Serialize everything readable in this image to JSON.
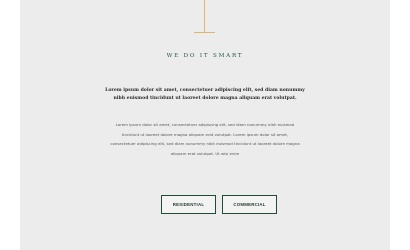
{
  "section": {
    "eyebrow": "WE DO IT SMART",
    "lead": "Lorem ipsum dolor sit amet, consectetuer adipiscing elit, sed diam nonummy nibh euismod tincidunt ut laoreet dolore magna aliquam erat volutpat.",
    "body": "Lorem ipsum dolor sit amet, consectetuer adipiscing elit, sed diam nonummy nibh euismod tincidunt ut laoreet dolore magna aliquam erat volutpat. Lorem ipsum dolor sit amet, consectetuer adipiscing elit, sed diam nonummy nibh euismod tincidunt ut laoreet dolore magna aliquam erat volutpat. Ut wisi enim"
  },
  "buttons": {
    "residential": "RESIDENTIAL",
    "commercial": "COMMERCIAL"
  },
  "colors": {
    "accent_line": "#e2b46a",
    "heading_green": "#1f5a3c",
    "button_border": "#1f4d36",
    "panel_bg": "#ececec"
  }
}
